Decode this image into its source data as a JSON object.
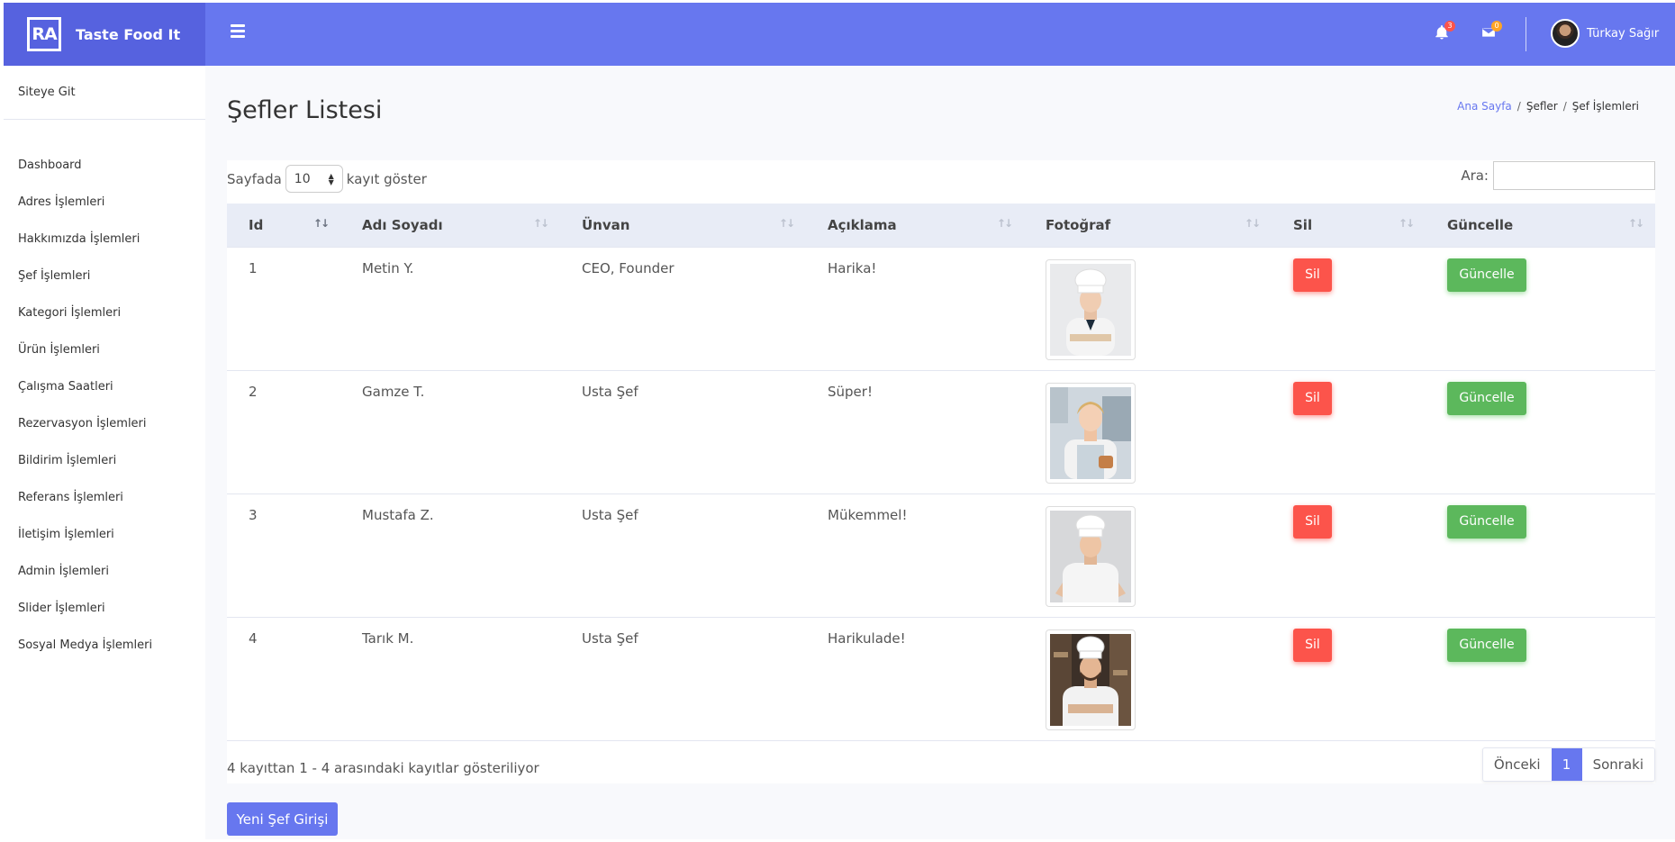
{
  "brand": {
    "logo": "RA",
    "name": "Taste Food It"
  },
  "topbar": {
    "notification_count": "3",
    "message_count": "0",
    "user_name": "Türkay Sağır",
    "colors": {
      "bar": "#6777ef",
      "brand": "#5662df",
      "bell_badge": "#fc544b",
      "mail_badge": "#ffa426"
    }
  },
  "sidebar": {
    "site_link": "Siteye Git",
    "items": [
      "Dashboard",
      "Adres İşlemleri",
      "Hakkımızda İşlemleri",
      "Şef İşlemleri",
      "Kategori İşlemleri",
      "Ürün İşlemleri",
      "Çalışma Saatleri",
      "Rezervasyon İşlemleri",
      "Bildirim İşlemleri",
      "Referans İşlemleri",
      "İletişim İşlemleri",
      "Admin İşlemleri",
      "Slider İşlemleri",
      "Sosyal Medya İşlemleri"
    ]
  },
  "page": {
    "title": "Şefler Listesi",
    "breadcrumb": {
      "home": "Ana Sayfa",
      "section": "Şefler",
      "current": "Şef İşlemleri"
    }
  },
  "table_controls": {
    "length_prefix": "Sayfada",
    "length_value": "10",
    "length_suffix": "kayıt göster",
    "search_label": "Ara:",
    "search_value": ""
  },
  "table": {
    "columns": [
      "Id",
      "Adı Soyadı",
      "Ünvan",
      "Açıklama",
      "Fotoğraf",
      "Sil",
      "Güncelle"
    ],
    "rows": [
      {
        "id": "1",
        "name": "Metin Y.",
        "title": "CEO, Founder",
        "desc": "Harika!",
        "photo": "chef-photo-woman-arms-crossed",
        "delete": "Sil",
        "update": "Güncelle"
      },
      {
        "id": "2",
        "name": "Gamze T.",
        "title": "Usta Şef",
        "desc": "Süper!",
        "photo": "chef-photo-woman-thumbs-up",
        "delete": "Sil",
        "update": "Güncelle"
      },
      {
        "id": "3",
        "name": "Mustafa Z.",
        "title": "Usta Şef",
        "desc": "Mükemmel!",
        "photo": "chef-photo-man-hands-on-hips",
        "delete": "Sil",
        "update": "Güncelle"
      },
      {
        "id": "4",
        "name": "Tarık M.",
        "title": "Usta Şef",
        "desc": "Harikulade!",
        "photo": "chef-photo-man-arms-crossed-kitchen",
        "delete": "Sil",
        "update": "Güncelle"
      }
    ]
  },
  "footer": {
    "info": "4 kayıttan 1 - 4 arasındaki kayıtlar gösteriliyor",
    "prev": "Önceki",
    "page": "1",
    "next": "Sonraki"
  },
  "actions": {
    "new_chef": "Yeni Şef Girişi"
  }
}
